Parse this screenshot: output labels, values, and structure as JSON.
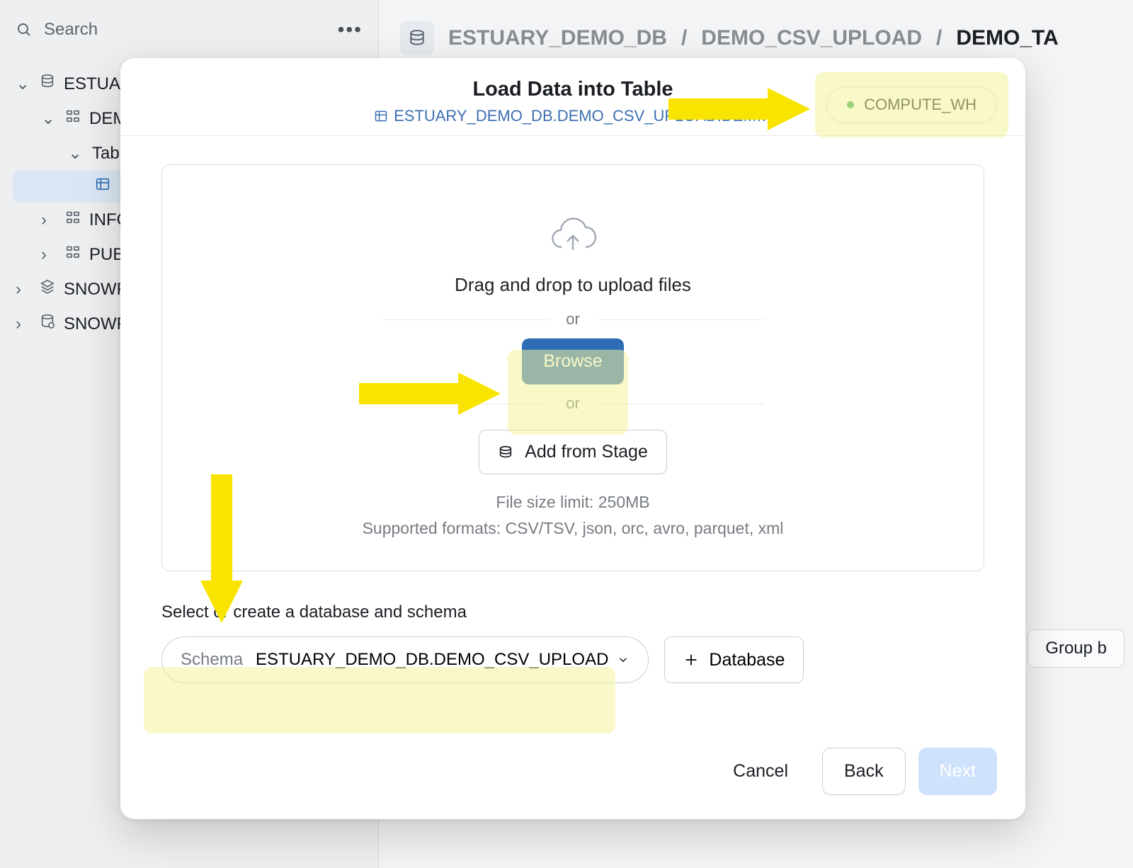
{
  "search": {
    "placeholder": "Search"
  },
  "tree": {
    "nodes": [
      {
        "label": "ESTUAR",
        "icon": "database",
        "expanded": true,
        "level": 0
      },
      {
        "label": "DEMO",
        "icon": "schema",
        "expanded": true,
        "level": 1
      },
      {
        "label": "Table",
        "icon": "none",
        "expanded": true,
        "level": 2
      },
      {
        "label": "",
        "icon": "table",
        "selected": true,
        "level": 3
      },
      {
        "label": "INFO",
        "icon": "schema",
        "expanded": false,
        "level": 1
      },
      {
        "label": "PUBL",
        "icon": "schema",
        "expanded": false,
        "level": 1
      },
      {
        "label": "SNOWFL",
        "icon": "share",
        "expanded": false,
        "level": 0
      },
      {
        "label": "SNOWFL",
        "icon": "share-db",
        "expanded": false,
        "level": 0
      }
    ]
  },
  "breadcrumb": {
    "parts": [
      "ESTUARY_DEMO_DB",
      "DEMO_CSV_UPLOAD",
      "DEMO_TA"
    ],
    "sep": " / "
  },
  "bg_snippet": "'_UPLOAD.DEM",
  "groupby": {
    "label": "Group b"
  },
  "modal": {
    "title": "Load Data into Table",
    "subtitle": "ESTUARY_DEMO_DB.DEMO_CSV_UPLOAD.DEM…",
    "warehouse": "COMPUTE_WH",
    "dropzone": {
      "primary": "Drag and drop to upload files",
      "or": "or",
      "browse": "Browse",
      "add_stage": "Add from Stage",
      "limit": "File size limit: 250MB",
      "formats": "Supported formats: CSV/TSV, json, orc, avro, parquet, xml"
    },
    "schema_section": {
      "heading": "Select or create a database and schema",
      "schema_label": "Schema",
      "schema_value": "ESTUARY_DEMO_DB.DEMO_CSV_UPLOAD",
      "database_button": "Database"
    },
    "footer": {
      "cancel": "Cancel",
      "back": "Back",
      "next": "Next"
    }
  }
}
